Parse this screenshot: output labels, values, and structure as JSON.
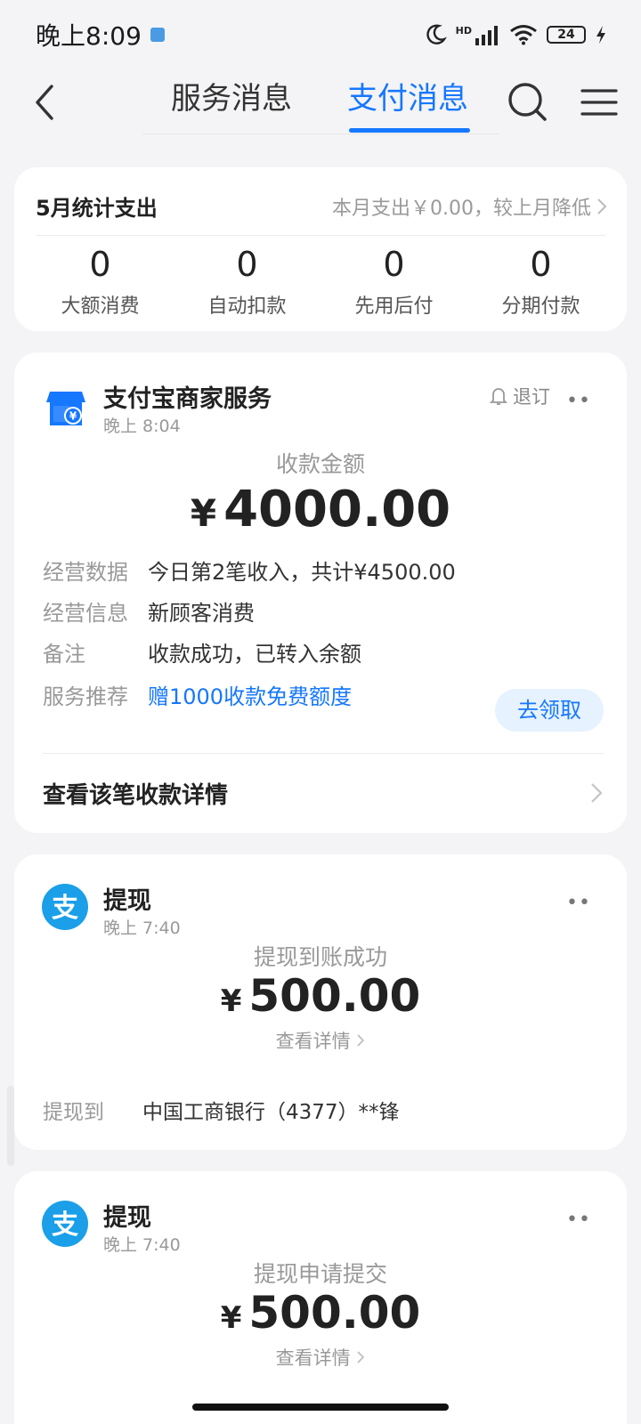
{
  "status_bar": {
    "time": "晚上8:09",
    "network": "HD",
    "battery": "24"
  },
  "nav": {
    "tabs": [
      {
        "label": "服务消息"
      },
      {
        "label": "支付消息"
      }
    ],
    "active_tab": "支付消息"
  },
  "stats": {
    "title": "5月统计支出",
    "summary": "本月支出￥0.00，较上月降低",
    "items": [
      {
        "value": "0",
        "label": "大额消费"
      },
      {
        "value": "0",
        "label": "自动扣款"
      },
      {
        "value": "0",
        "label": "先用后付"
      },
      {
        "value": "0",
        "label": "分期付款"
      }
    ]
  },
  "merchant_card": {
    "title": "支付宝商家服务",
    "time": "晚上 8:04",
    "unsubscribe": "退订",
    "more": "••",
    "amount_label": "收款金额",
    "currency": "¥",
    "amount": "4000.00",
    "rows": [
      {
        "key": "经营数据",
        "value": "今日第2笔收入，共计¥4500.00"
      },
      {
        "key": "经营信息",
        "value": "新顾客消费"
      },
      {
        "key": "备注",
        "value": "收款成功，已转入余额"
      },
      {
        "key": "服务推荐",
        "value": "赠1000收款免费额度"
      }
    ],
    "claim_button": "去领取",
    "detail_link": "查看该笔收款详情"
  },
  "withdraw_cards": [
    {
      "title": "提现",
      "time": "晚上 7:40",
      "more": "••",
      "status": "提现到账成功",
      "currency": "¥",
      "amount": "500.00",
      "view_detail": "查看详情",
      "bank_key": "提现到",
      "bank_value": "中国工商银行（4377）**锋"
    },
    {
      "title": "提现",
      "time": "晚上 7:40",
      "more": "••",
      "status": "提现申请提交",
      "currency": "¥",
      "amount": "500.00",
      "view_detail": "查看详情"
    }
  ],
  "colors": {
    "accent": "#1677ff",
    "background": "#f4f4f6",
    "card": "#ffffff",
    "alipay_blue": "#1a9fe8"
  }
}
